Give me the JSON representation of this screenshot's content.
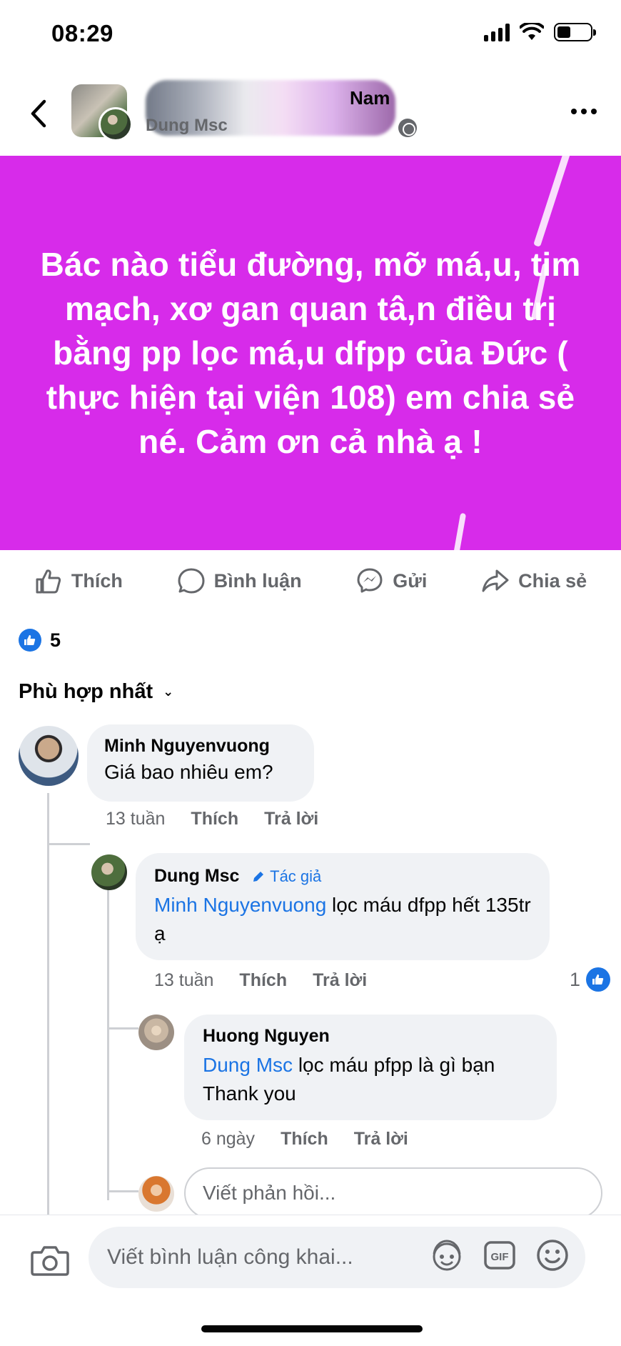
{
  "status_bar": {
    "time": "08:29"
  },
  "header": {
    "page_title_partial": "Nam",
    "author_name": "Dung Msc"
  },
  "post": {
    "background": "#d72bea",
    "text": "Bác nào tiểu đường, mỡ má,u, tim mạch, xơ gan quan tâ,n điều trị bằng pp lọc má,u dfpp của Đức ( thực hiện tại viện 108) em chia sẻ né. Cảm ơn cả nhà ạ !"
  },
  "actions": {
    "like": "Thích",
    "comment": "Bình luận",
    "send": "Gửi",
    "share": "Chia sẻ"
  },
  "reactions": {
    "count": "5"
  },
  "sort": {
    "label": "Phù hợp nhất"
  },
  "comments": [
    {
      "name": "Minh Nguyenvuong",
      "text": "Giá bao nhiêu em?",
      "time": "13 tuần",
      "like": "Thích",
      "reply": "Trả lời"
    },
    {
      "name": "Dung Msc",
      "badge": "Tác giả",
      "mention": "Minh Nguyenvuong",
      "text": " lọc máu dfpp hết 135tr ạ",
      "time": "13 tuần",
      "like": "Thích",
      "reply": "Trả lời",
      "like_count": "1"
    },
    {
      "name": "Huong Nguyen",
      "mention": "Dung Msc",
      "text": " lọc máu pfpp là gì bạn Thank you",
      "time": "6 ngày",
      "like": "Thích",
      "reply": "Trả lời"
    }
  ],
  "reply_box": {
    "placeholder": "Viết phản hồi..."
  },
  "comment_box": {
    "placeholder": "Viết bình luận công khai..."
  },
  "colors": {
    "accent": "#1b74e4",
    "muted": "#65676b",
    "bubble": "#f0f2f5"
  }
}
